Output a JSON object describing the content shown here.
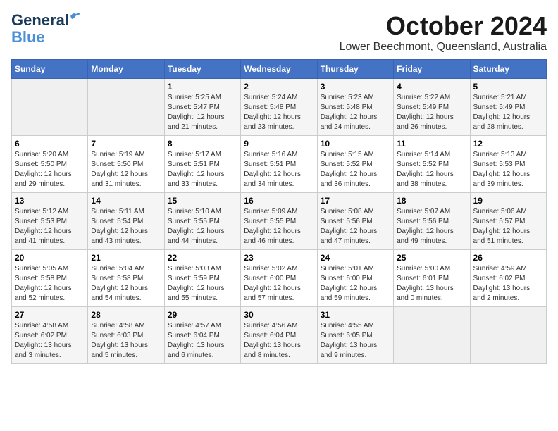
{
  "header": {
    "logo_line1": "General",
    "logo_line2": "Blue",
    "month": "October 2024",
    "location": "Lower Beechmont, Queensland, Australia"
  },
  "weekdays": [
    "Sunday",
    "Monday",
    "Tuesday",
    "Wednesday",
    "Thursday",
    "Friday",
    "Saturday"
  ],
  "weeks": [
    [
      {
        "day": "",
        "sunrise": "",
        "sunset": "",
        "daylight": ""
      },
      {
        "day": "",
        "sunrise": "",
        "sunset": "",
        "daylight": ""
      },
      {
        "day": "1",
        "sunrise": "Sunrise: 5:25 AM",
        "sunset": "Sunset: 5:47 PM",
        "daylight": "Daylight: 12 hours and 21 minutes."
      },
      {
        "day": "2",
        "sunrise": "Sunrise: 5:24 AM",
        "sunset": "Sunset: 5:48 PM",
        "daylight": "Daylight: 12 hours and 23 minutes."
      },
      {
        "day": "3",
        "sunrise": "Sunrise: 5:23 AM",
        "sunset": "Sunset: 5:48 PM",
        "daylight": "Daylight: 12 hours and 24 minutes."
      },
      {
        "day": "4",
        "sunrise": "Sunrise: 5:22 AM",
        "sunset": "Sunset: 5:49 PM",
        "daylight": "Daylight: 12 hours and 26 minutes."
      },
      {
        "day": "5",
        "sunrise": "Sunrise: 5:21 AM",
        "sunset": "Sunset: 5:49 PM",
        "daylight": "Daylight: 12 hours and 28 minutes."
      }
    ],
    [
      {
        "day": "6",
        "sunrise": "Sunrise: 5:20 AM",
        "sunset": "Sunset: 5:50 PM",
        "daylight": "Daylight: 12 hours and 29 minutes."
      },
      {
        "day": "7",
        "sunrise": "Sunrise: 5:19 AM",
        "sunset": "Sunset: 5:50 PM",
        "daylight": "Daylight: 12 hours and 31 minutes."
      },
      {
        "day": "8",
        "sunrise": "Sunrise: 5:17 AM",
        "sunset": "Sunset: 5:51 PM",
        "daylight": "Daylight: 12 hours and 33 minutes."
      },
      {
        "day": "9",
        "sunrise": "Sunrise: 5:16 AM",
        "sunset": "Sunset: 5:51 PM",
        "daylight": "Daylight: 12 hours and 34 minutes."
      },
      {
        "day": "10",
        "sunrise": "Sunrise: 5:15 AM",
        "sunset": "Sunset: 5:52 PM",
        "daylight": "Daylight: 12 hours and 36 minutes."
      },
      {
        "day": "11",
        "sunrise": "Sunrise: 5:14 AM",
        "sunset": "Sunset: 5:52 PM",
        "daylight": "Daylight: 12 hours and 38 minutes."
      },
      {
        "day": "12",
        "sunrise": "Sunrise: 5:13 AM",
        "sunset": "Sunset: 5:53 PM",
        "daylight": "Daylight: 12 hours and 39 minutes."
      }
    ],
    [
      {
        "day": "13",
        "sunrise": "Sunrise: 5:12 AM",
        "sunset": "Sunset: 5:53 PM",
        "daylight": "Daylight: 12 hours and 41 minutes."
      },
      {
        "day": "14",
        "sunrise": "Sunrise: 5:11 AM",
        "sunset": "Sunset: 5:54 PM",
        "daylight": "Daylight: 12 hours and 43 minutes."
      },
      {
        "day": "15",
        "sunrise": "Sunrise: 5:10 AM",
        "sunset": "Sunset: 5:55 PM",
        "daylight": "Daylight: 12 hours and 44 minutes."
      },
      {
        "day": "16",
        "sunrise": "Sunrise: 5:09 AM",
        "sunset": "Sunset: 5:55 PM",
        "daylight": "Daylight: 12 hours and 46 minutes."
      },
      {
        "day": "17",
        "sunrise": "Sunrise: 5:08 AM",
        "sunset": "Sunset: 5:56 PM",
        "daylight": "Daylight: 12 hours and 47 minutes."
      },
      {
        "day": "18",
        "sunrise": "Sunrise: 5:07 AM",
        "sunset": "Sunset: 5:56 PM",
        "daylight": "Daylight: 12 hours and 49 minutes."
      },
      {
        "day": "19",
        "sunrise": "Sunrise: 5:06 AM",
        "sunset": "Sunset: 5:57 PM",
        "daylight": "Daylight: 12 hours and 51 minutes."
      }
    ],
    [
      {
        "day": "20",
        "sunrise": "Sunrise: 5:05 AM",
        "sunset": "Sunset: 5:58 PM",
        "daylight": "Daylight: 12 hours and 52 minutes."
      },
      {
        "day": "21",
        "sunrise": "Sunrise: 5:04 AM",
        "sunset": "Sunset: 5:58 PM",
        "daylight": "Daylight: 12 hours and 54 minutes."
      },
      {
        "day": "22",
        "sunrise": "Sunrise: 5:03 AM",
        "sunset": "Sunset: 5:59 PM",
        "daylight": "Daylight: 12 hours and 55 minutes."
      },
      {
        "day": "23",
        "sunrise": "Sunrise: 5:02 AM",
        "sunset": "Sunset: 6:00 PM",
        "daylight": "Daylight: 12 hours and 57 minutes."
      },
      {
        "day": "24",
        "sunrise": "Sunrise: 5:01 AM",
        "sunset": "Sunset: 6:00 PM",
        "daylight": "Daylight: 12 hours and 59 minutes."
      },
      {
        "day": "25",
        "sunrise": "Sunrise: 5:00 AM",
        "sunset": "Sunset: 6:01 PM",
        "daylight": "Daylight: 13 hours and 0 minutes."
      },
      {
        "day": "26",
        "sunrise": "Sunrise: 4:59 AM",
        "sunset": "Sunset: 6:02 PM",
        "daylight": "Daylight: 13 hours and 2 minutes."
      }
    ],
    [
      {
        "day": "27",
        "sunrise": "Sunrise: 4:58 AM",
        "sunset": "Sunset: 6:02 PM",
        "daylight": "Daylight: 13 hours and 3 minutes."
      },
      {
        "day": "28",
        "sunrise": "Sunrise: 4:58 AM",
        "sunset": "Sunset: 6:03 PM",
        "daylight": "Daylight: 13 hours and 5 minutes."
      },
      {
        "day": "29",
        "sunrise": "Sunrise: 4:57 AM",
        "sunset": "Sunset: 6:04 PM",
        "daylight": "Daylight: 13 hours and 6 minutes."
      },
      {
        "day": "30",
        "sunrise": "Sunrise: 4:56 AM",
        "sunset": "Sunset: 6:04 PM",
        "daylight": "Daylight: 13 hours and 8 minutes."
      },
      {
        "day": "31",
        "sunrise": "Sunrise: 4:55 AM",
        "sunset": "Sunset: 6:05 PM",
        "daylight": "Daylight: 13 hours and 9 minutes."
      },
      {
        "day": "",
        "sunrise": "",
        "sunset": "",
        "daylight": ""
      },
      {
        "day": "",
        "sunrise": "",
        "sunset": "",
        "daylight": ""
      }
    ]
  ]
}
